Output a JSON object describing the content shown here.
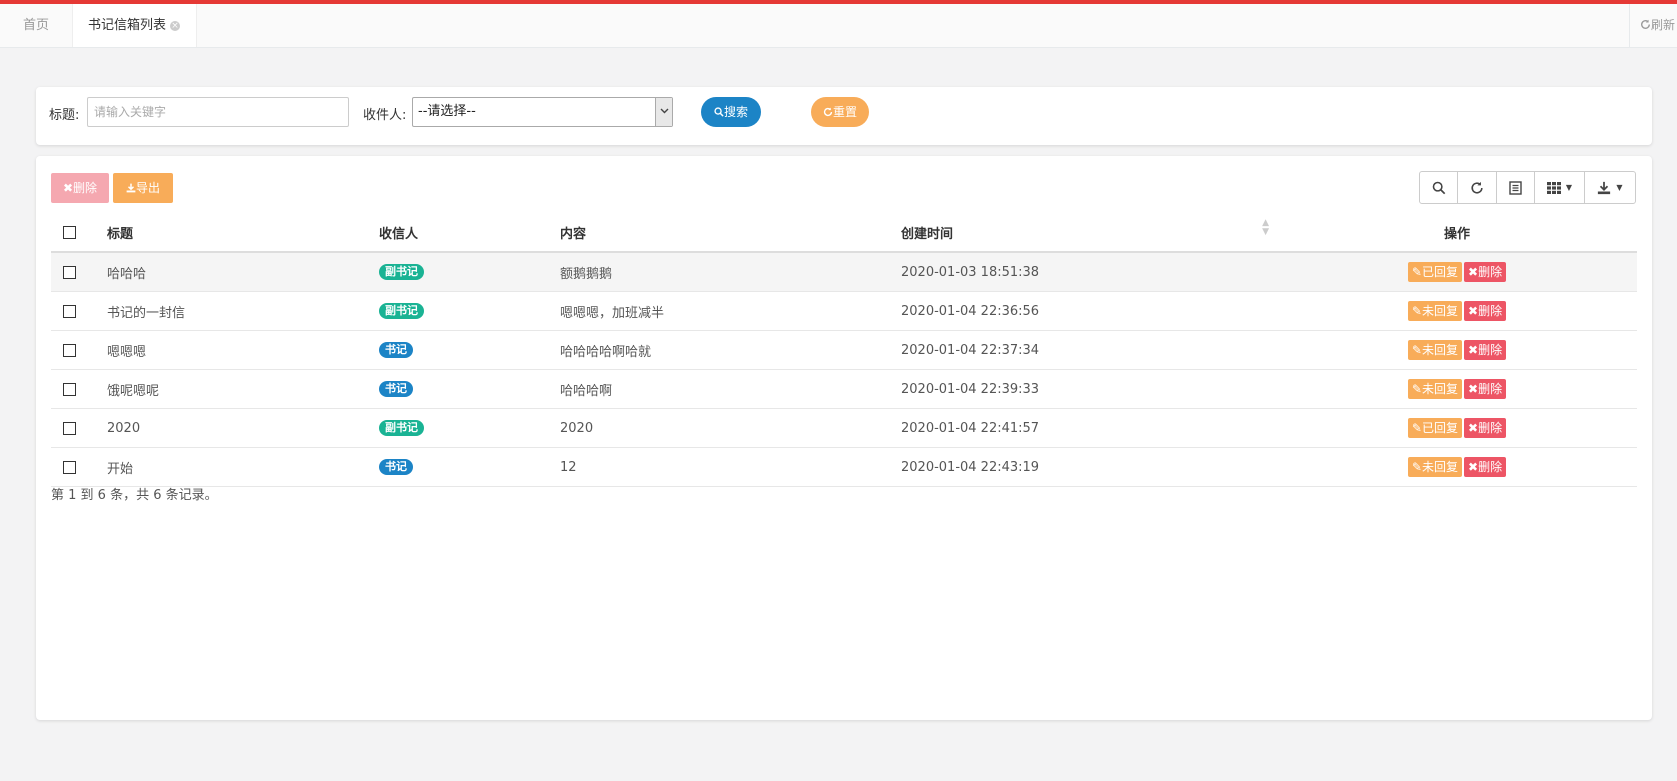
{
  "colors": {
    "accent_red": "#e53935",
    "blue": "#1c84c6",
    "green": "#1ab394",
    "orange": "#f8ac59",
    "danger": "#ed5565"
  },
  "tabs": {
    "home": "首页",
    "active": "书记信箱列表",
    "refresh_icon": "refresh-icon",
    "refresh": "刷新"
  },
  "search": {
    "title_label": "标题:",
    "title_placeholder": "请输入关键字",
    "recipient_label": "收件人:",
    "recipient_value": "--请选择--",
    "search_button": "搜索",
    "search_icon": "search-icon",
    "reset_button": "重置",
    "reset_icon": "refresh-icon"
  },
  "toolbar": {
    "delete_label": "删除",
    "delete_icon": "close-icon",
    "export_label": "导出",
    "export_icon": "download-icon",
    "tools": [
      "search-icon",
      "refresh-icon",
      "list-icon",
      "grid-icon",
      "download-icon"
    ]
  },
  "table": {
    "headers": {
      "title": "标题",
      "recipient": "收信人",
      "content": "内容",
      "created": "创建时间",
      "actions": "操作"
    },
    "rows": [
      {
        "title": "哈哈哈",
        "recipient": "副书记",
        "recipient_type": "green",
        "content": "额鹅鹅鹅",
        "created": "2020-01-03 18:51:38",
        "status": "已回复",
        "delete": "删除"
      },
      {
        "title": "书记的一封信",
        "recipient": "副书记",
        "recipient_type": "green",
        "content": "嗯嗯嗯，加班减半",
        "created": "2020-01-04 22:36:56",
        "status": "未回复",
        "delete": "删除"
      },
      {
        "title": "嗯嗯嗯",
        "recipient": "书记",
        "recipient_type": "blue",
        "content": "哈哈哈哈啊哈就",
        "created": "2020-01-04 22:37:34",
        "status": "未回复",
        "delete": "删除"
      },
      {
        "title": "饿呢嗯呢",
        "recipient": "书记",
        "recipient_type": "blue",
        "content": "哈哈哈啊",
        "created": "2020-01-04 22:39:33",
        "status": "未回复",
        "delete": "删除"
      },
      {
        "title": "2020",
        "recipient": "副书记",
        "recipient_type": "green",
        "content": "2020",
        "created": "2020-01-04 22:41:57",
        "status": "已回复",
        "delete": "删除"
      },
      {
        "title": "开始",
        "recipient": "书记",
        "recipient_type": "blue",
        "content": "12",
        "created": "2020-01-04 22:43:19",
        "status": "未回复",
        "delete": "删除"
      }
    ],
    "pagination_info": "第 1 到 6 条，共 6 条记录。"
  }
}
